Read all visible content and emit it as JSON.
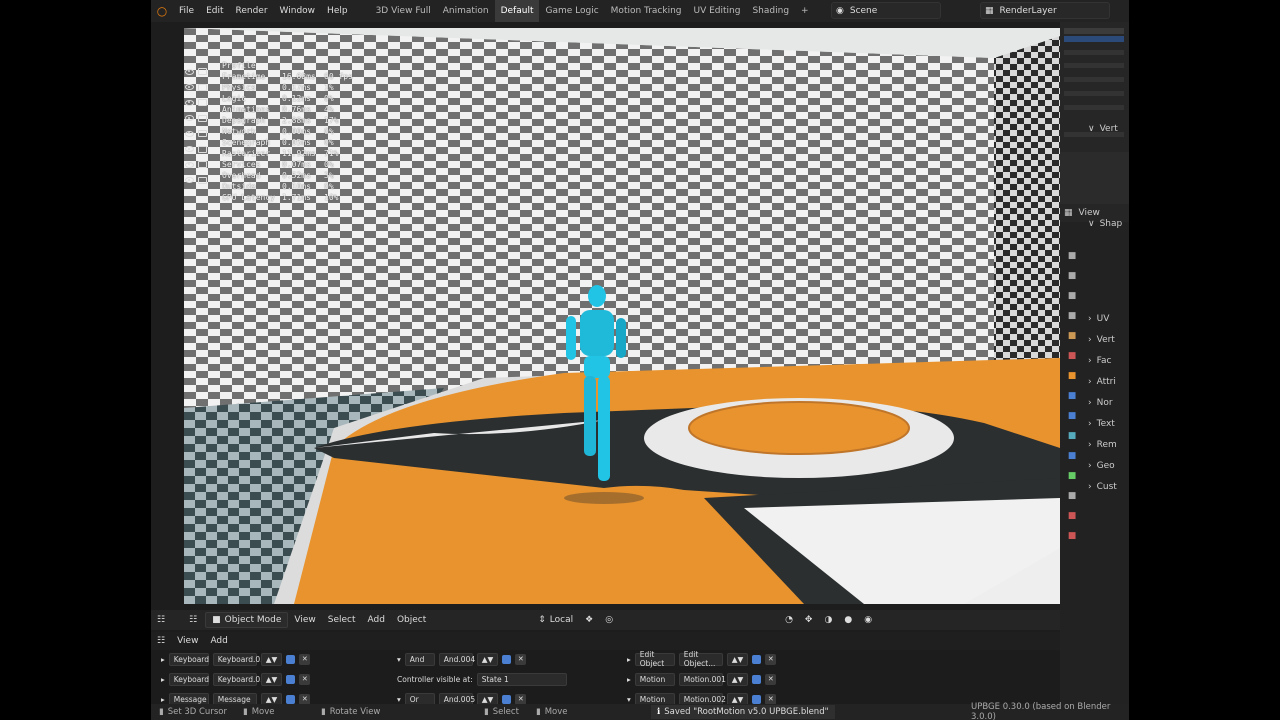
{
  "menu": [
    "File",
    "Edit",
    "Render",
    "Window",
    "Help"
  ],
  "workspaces": [
    "3D View Full",
    "Animation",
    "Default",
    "Game Logic",
    "Motion Tracking",
    "UV Editing",
    "Shading"
  ],
  "active_workspace": "Default",
  "scene_name": "Scene",
  "render_layer": "RenderLayer",
  "profile": {
    "title": "Profile",
    "rows": [
      {
        "name": "Frametime",
        "val": "16.68ms",
        "pct": "60 fps"
      },
      {
        "name": "Physics",
        "val": "0.17ms",
        "pct": "1%"
      },
      {
        "name": "Logic",
        "val": "0.12ms",
        "pct": "0%"
      },
      {
        "name": "Animations",
        "val": "0.76ms",
        "pct": "4%"
      },
      {
        "name": "Depsgraph",
        "val": "2.88ms",
        "pct": "17%"
      },
      {
        "name": "Network",
        "val": "0.00ms",
        "pct": "0%"
      },
      {
        "name": "Scenegraph",
        "val": "0.05ms",
        "pct": "0%"
      },
      {
        "name": "Rasterizer",
        "val": "11.92ms",
        "pct": "71%"
      },
      {
        "name": "Services",
        "val": "0.07ms",
        "pct": "0%"
      },
      {
        "name": "Overhead",
        "val": "0.52ms",
        "pct": "3%"
      },
      {
        "name": "Outside",
        "val": "0.10ms",
        "pct": "0%"
      },
      {
        "name": "GPU Latency",
        "val": "1.71ms",
        "pct": "10%"
      }
    ]
  },
  "header": {
    "mode": "Object Mode",
    "view": "View",
    "select": "Select",
    "add": "Add",
    "object": "Object",
    "transform": "Local"
  },
  "logic_menu": {
    "view": "View",
    "add": "Add"
  },
  "sensors": [
    {
      "type": "Keyboard",
      "name": "Keyboard.0..."
    },
    {
      "type": "Keyboard",
      "name": "Keyboard.0..."
    },
    {
      "type": "Message",
      "name": "Message"
    }
  ],
  "controllers": {
    "first_type": "And",
    "first_name": "And.004",
    "visible_label": "Controller visible at:",
    "state": "State 1",
    "second_type": "Or",
    "second_name": "And.005"
  },
  "actuators": [
    {
      "type": "Edit Object",
      "name": "Edit Object..."
    },
    {
      "type": "Motion",
      "name": "Motion.001"
    },
    {
      "type": "Motion",
      "name": "Motion.002"
    }
  ],
  "props_header": "View",
  "props_sections": [
    "Vert",
    "Shap",
    "UV",
    "Vert",
    "Fac",
    "Attri",
    "Nor",
    "Text",
    "Rem",
    "Geo",
    "Cust"
  ],
  "status": {
    "cursor": "Set 3D Cursor",
    "move": "Move",
    "rotate": "Rotate View",
    "select": "Select",
    "move2": "Move",
    "saved": "Saved \"RootMotion v5.0 UPBGE.blend\"",
    "version": "UPBGE 0.30.0 (based on Blender 3.0.0)"
  },
  "colors": {
    "accent": "#4a7fd1",
    "character": "#22c4e6",
    "floor": "#e8932e"
  }
}
